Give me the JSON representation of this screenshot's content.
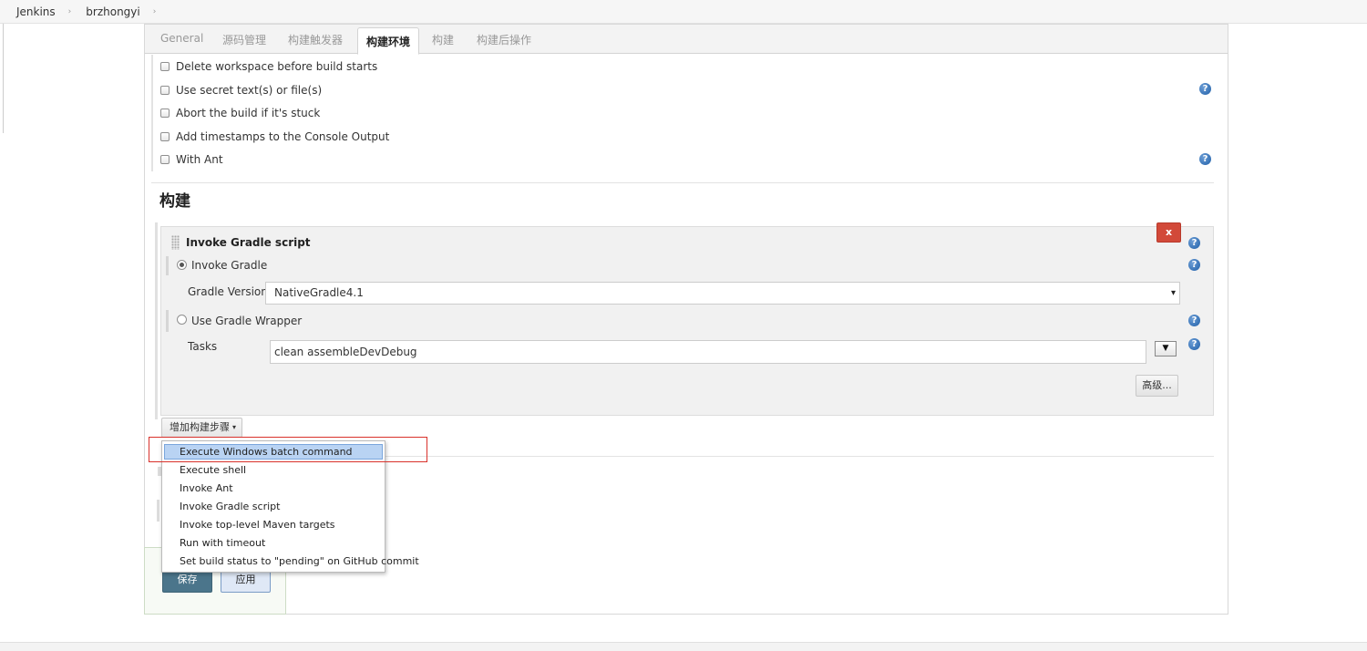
{
  "breadcrumb": {
    "items": [
      "Jenkins",
      "brzhongyi"
    ],
    "separator": "›"
  },
  "tabs": [
    {
      "label": "General"
    },
    {
      "label": "源码管理"
    },
    {
      "label": "构建触发器"
    },
    {
      "label": "构建环境"
    },
    {
      "label": "构建"
    },
    {
      "label": "构建后操作"
    }
  ],
  "active_tab": "构建环境",
  "build_env_options": [
    {
      "label": "Delete workspace before build starts",
      "checked": false
    },
    {
      "label": "Use secret text(s) or file(s)",
      "checked": false
    },
    {
      "label": "Abort the build if it's stuck",
      "checked": false
    },
    {
      "label": "Add timestamps to the Console Output",
      "checked": false
    },
    {
      "label": "With Ant",
      "checked": false
    }
  ],
  "help_glyph": "?",
  "build_section": {
    "title": "构建",
    "step": {
      "title": "Invoke Gradle script",
      "close_label": "x",
      "invoke_gradle_label": "Invoke Gradle",
      "invoke_gradle_selected": true,
      "gradle_version_label": "Gradle Version",
      "gradle_version_value": "NativeGradle4.1",
      "select_caret": "▾",
      "use_wrapper_label": "Use Gradle Wrapper",
      "use_wrapper_selected": false,
      "tasks_label": "Tasks",
      "tasks_value": "clean assembleDevDebug",
      "expand_glyph": "▼",
      "advanced_label": "高级..."
    },
    "add_step_label": "增加构建步骤",
    "add_step_caret": "▾"
  },
  "dropdown": {
    "items": [
      "Execute Windows batch command",
      "Execute shell",
      "Invoke Ant",
      "Invoke Gradle script",
      "Invoke top-level Maven targets",
      "Run with timeout",
      "Set build status to \"pending\" on GitHub commit"
    ],
    "highlighted_index": 0
  },
  "actions": {
    "save_label": "保存",
    "apply_label": "应用"
  },
  "colors": {
    "close_button": "#d24939",
    "save_button": "#4b758b",
    "apply_button": "#dfe8f6",
    "annotation_box": "#d9312b",
    "dropdown_highlight": "#b9d3f3",
    "help_icon": "#1f5fa8"
  },
  "icons": {
    "help": "help-icon",
    "drag": "drag-handle-icon",
    "close": "close-icon",
    "caret": "chevron-down-icon"
  }
}
